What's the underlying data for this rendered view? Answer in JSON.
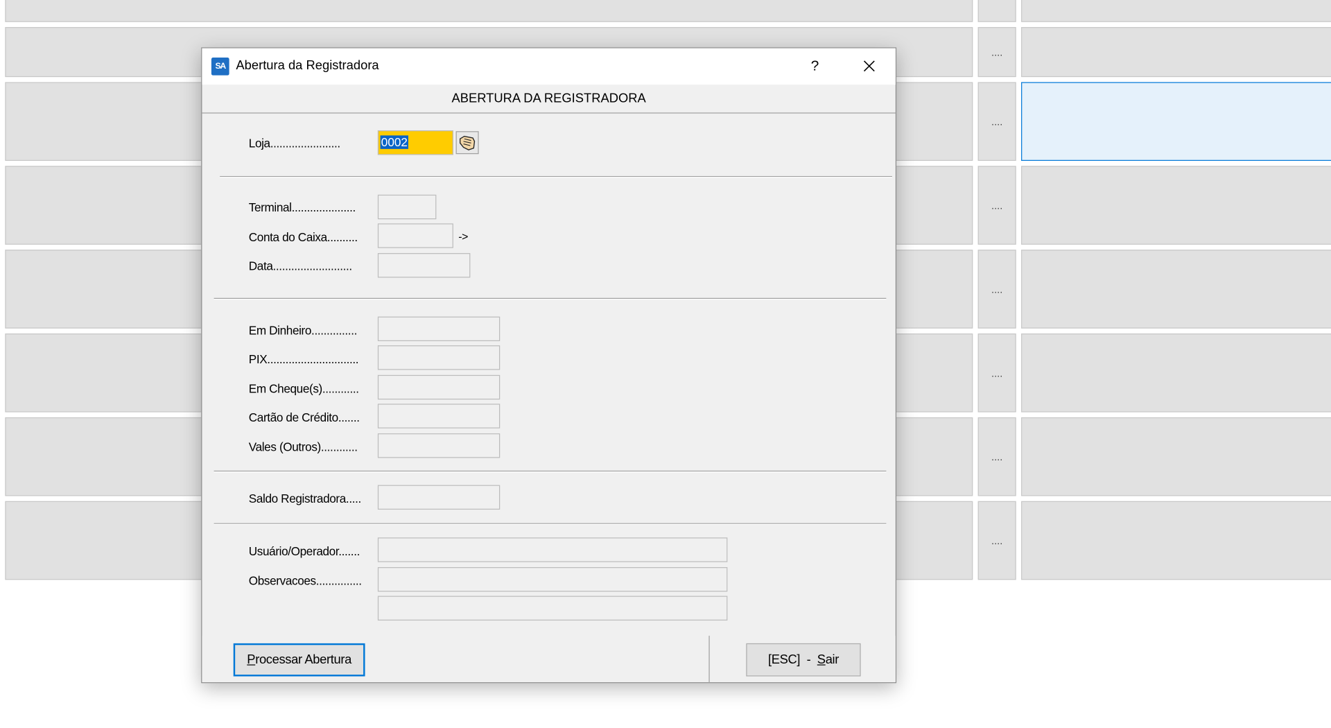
{
  "background": {
    "row_button_label": "...."
  },
  "dialog": {
    "app_icon_text": "SA",
    "title": "Abertura da Registradora",
    "help_label": "?",
    "header": "ABERTURA DA REGISTRADORA",
    "labels": {
      "loja": "Loja.......................",
      "terminal": "Terminal.....................",
      "conta_caixa": "Conta do Caixa..........",
      "data": "Data..........................",
      "em_dinheiro": "Em Dinheiro...............",
      "pix": "PIX..............................",
      "em_cheques": "Em Cheque(s)............",
      "cartao_credito": "Cartão de Crédito.......",
      "vales": "Vales (Outros)............",
      "saldo": "Saldo Registradora.....",
      "usuario": "Usuário/Operador.......",
      "observacoes": "Observacoes..............."
    },
    "values": {
      "loja": "0002"
    },
    "arrow": "->",
    "buttons": {
      "process_mnemonic": "P",
      "process_rest": "rocessar Abertura",
      "exit_prefix": "[ESC]  -  ",
      "exit_mnemonic": "S",
      "exit_rest": "air"
    }
  },
  "colors": {
    "highlight_field": "#ffcc00",
    "selection": "#0a64c8",
    "focus_border": "#0078d7"
  }
}
